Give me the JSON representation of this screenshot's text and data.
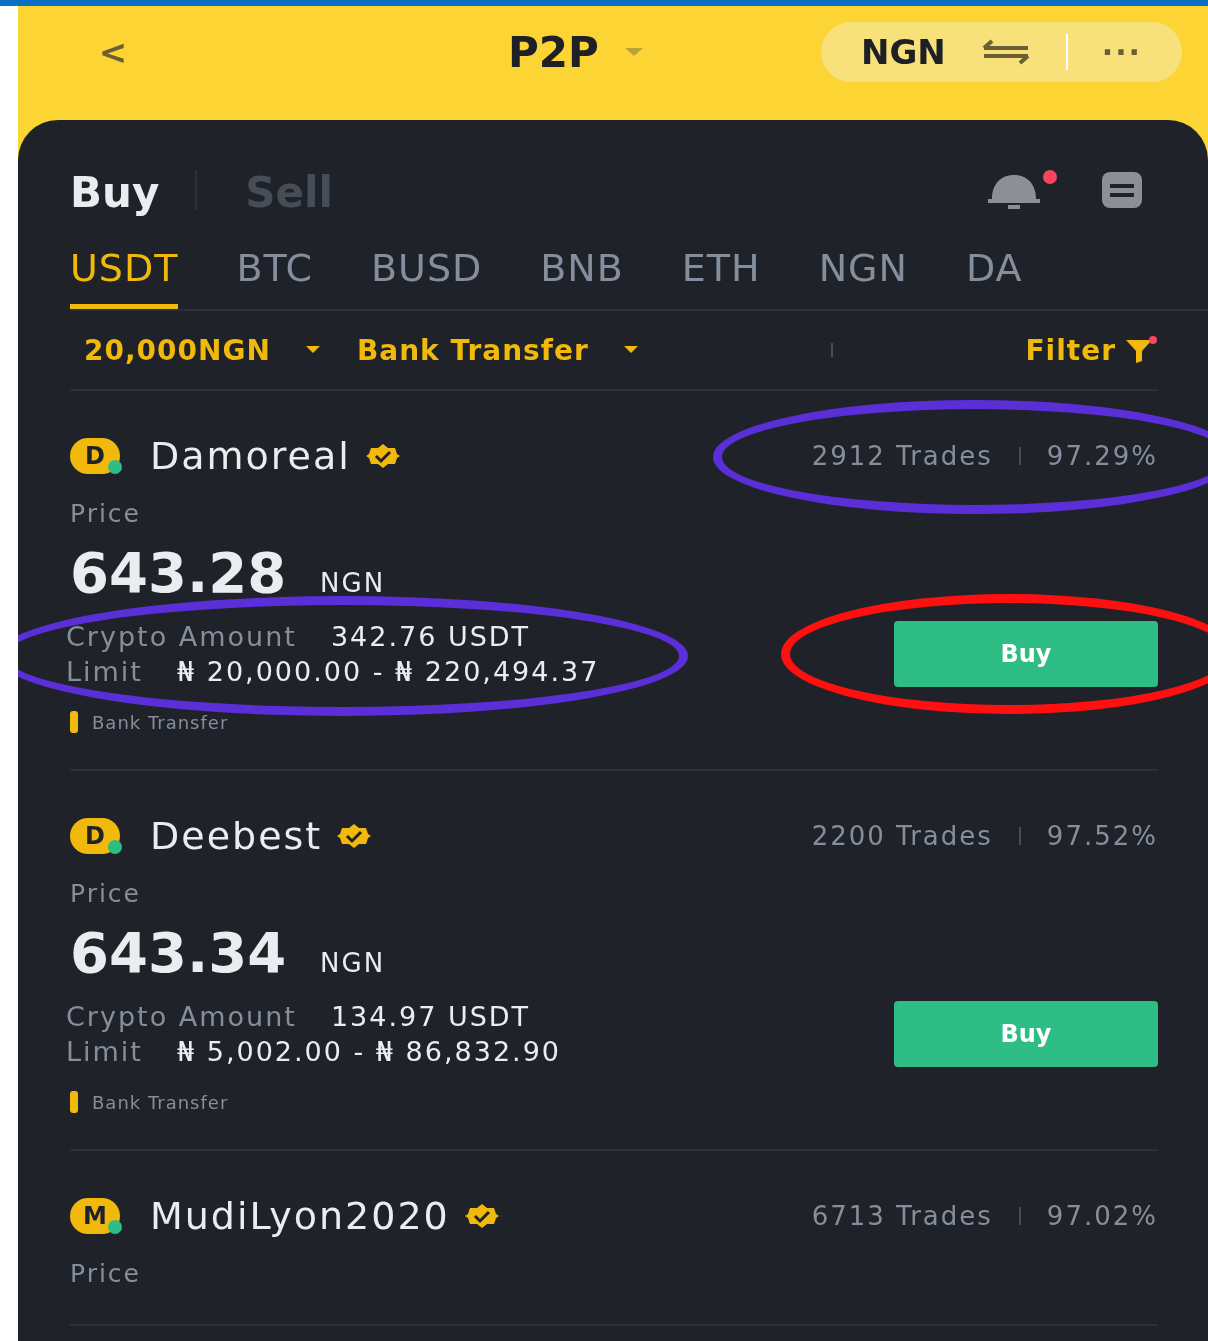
{
  "header": {
    "back": "<",
    "title": "P2P",
    "currency": "NGN",
    "more": "···"
  },
  "trade_tabs": [
    {
      "label": "Buy",
      "selected": true
    },
    {
      "label": "Sell",
      "selected": false
    }
  ],
  "notifications": {
    "unread": true
  },
  "coin_tabs": [
    {
      "label": "USDT",
      "selected": true
    },
    {
      "label": "BTC",
      "selected": false
    },
    {
      "label": "BUSD",
      "selected": false
    },
    {
      "label": "BNB",
      "selected": false
    },
    {
      "label": "ETH",
      "selected": false
    },
    {
      "label": "NGN",
      "selected": false
    },
    {
      "label": "DA",
      "selected": false
    }
  ],
  "filters": {
    "amount": "20,000NGN",
    "payment": "Bank Transfer",
    "filter": "Filter",
    "filter_active": true
  },
  "listings": [
    {
      "avatar": "D",
      "name": "Damoreal",
      "verified": true,
      "trades": "2912 Trades",
      "completion": "97.29%",
      "price_label": "Price",
      "price": "643.28",
      "price_currency": "NGN",
      "amount_label": "Crypto Amount",
      "amount": "342.76 USDT",
      "limit_label": "Limit",
      "limit": "₦ 20,000.00 - ₦ 220,494.37",
      "button": "Buy",
      "payment": "Bank Transfer",
      "stats_circled": true,
      "amounts_circled": true,
      "button_circled": true
    },
    {
      "avatar": "D",
      "name": "Deebest",
      "verified": true,
      "trades": "2200 Trades",
      "completion": "97.52%",
      "price_label": "Price",
      "price": "643.34",
      "price_currency": "NGN",
      "amount_label": "Crypto Amount",
      "amount": "134.97 USDT",
      "limit_label": "Limit",
      "limit": "₦ 5,002.00 - ₦ 86,832.90",
      "button": "Buy",
      "payment": "Bank Transfer",
      "stats_circled": false,
      "amounts_circled": false,
      "button_circled": false
    },
    {
      "avatar": "M",
      "name": "MudiLyon2020",
      "verified": true,
      "trades": "6713 Trades",
      "completion": "97.02%",
      "price_label": "Price",
      "stats_circled": false
    }
  ]
}
